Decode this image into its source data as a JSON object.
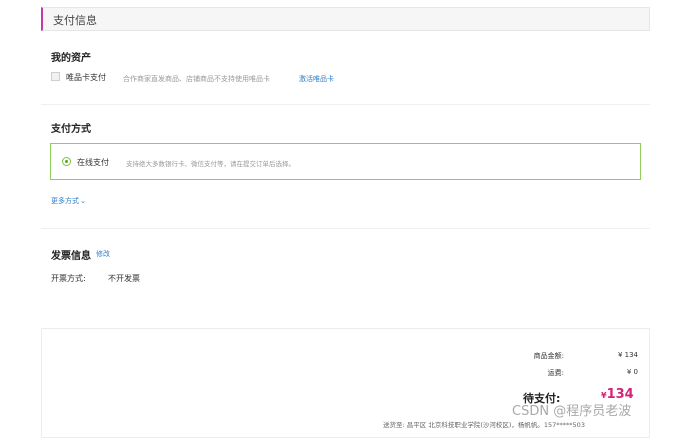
{
  "header": {
    "title": "支付信息"
  },
  "assets": {
    "title": "我的资产",
    "vip_card_label": "唯品卡支付",
    "vip_card_note": "合作商家直发商品、店铺商品不支持使用唯品卡",
    "activate_link": "激活唯品卡"
  },
  "payment": {
    "title": "支付方式",
    "online_label": "在线支付",
    "online_desc": "支持绝大多数银行卡、微信支付等，请在提交订单后选择。",
    "more_methods": "更多方式",
    "more_icon": "chevron-down-icon"
  },
  "invoice": {
    "title": "发票信息",
    "edit_link": "修改",
    "type_label": "开票方式:",
    "type_value": "不开发票"
  },
  "summary": {
    "goods_amount_label": "商品金额:",
    "goods_amount_value": "¥ 134",
    "shipping_label": "运费:",
    "shipping_value": "¥ 0",
    "due_label": "待支付:",
    "due_currency": "¥",
    "due_value": "134",
    "address": "送货至:  昌平区 北京科技职业学院(沙河校区)，杨帆帆。157*****503"
  },
  "watermark": "CSDN @程序员老波",
  "colors": {
    "accent": "#c33aa8",
    "price": "#d4237a",
    "link": "#2f7dc8",
    "online_border": "#8fce5a"
  }
}
